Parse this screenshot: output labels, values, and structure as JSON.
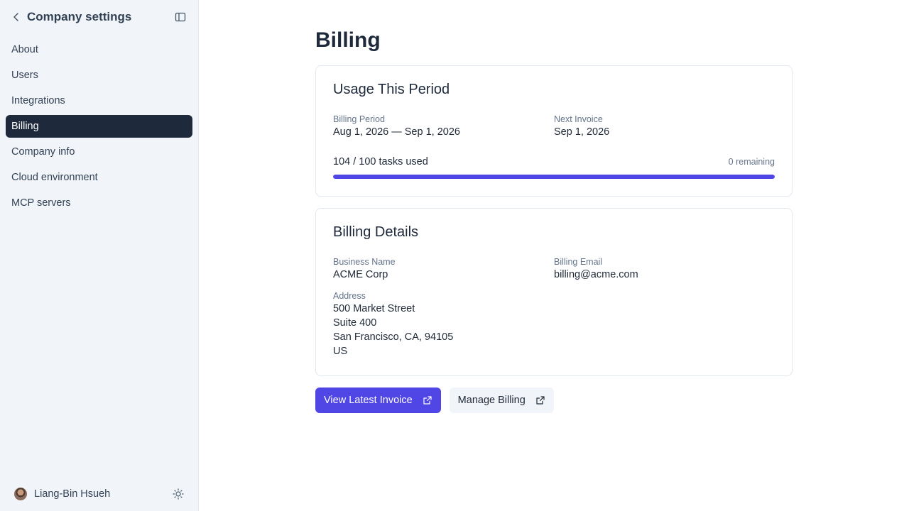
{
  "sidebar": {
    "title": "Company settings",
    "items": [
      {
        "label": "About"
      },
      {
        "label": "Users"
      },
      {
        "label": "Integrations"
      },
      {
        "label": "Billing"
      },
      {
        "label": "Company info"
      },
      {
        "label": "Cloud environment"
      },
      {
        "label": "MCP servers"
      }
    ],
    "active_index": 3,
    "user_name": "Liang-Bin Hsueh"
  },
  "page": {
    "title": "Billing"
  },
  "usage": {
    "title": "Usage This Period",
    "billing_period_label": "Billing Period",
    "billing_period_value": "Aug 1, 2026 — Sep 1, 2026",
    "next_invoice_label": "Next Invoice",
    "next_invoice_value": "Sep 1, 2026",
    "tasks_used_text": "104 / 100 tasks used",
    "remaining_text": "0 remaining",
    "progress_fraction": 1.0
  },
  "details": {
    "title": "Billing Details",
    "business_name_label": "Business Name",
    "business_name_value": "ACME Corp",
    "billing_email_label": "Billing Email",
    "billing_email_value": "billing@acme.com",
    "address_label": "Address",
    "address_lines": [
      "500 Market Street",
      "Suite 400",
      "San Francisco, CA, 94105",
      "US"
    ]
  },
  "actions": {
    "view_invoice_label": "View Latest Invoice",
    "manage_billing_label": "Manage Billing"
  },
  "colors": {
    "accent": "#4f46e5",
    "active_nav": "#1e293b",
    "sidebar_bg": "#f1f5f9"
  },
  "icons": {
    "back": "chevron-left-icon",
    "sidebar_toggle": "panel-left-icon",
    "theme": "sun-icon",
    "external": "external-link-icon"
  }
}
